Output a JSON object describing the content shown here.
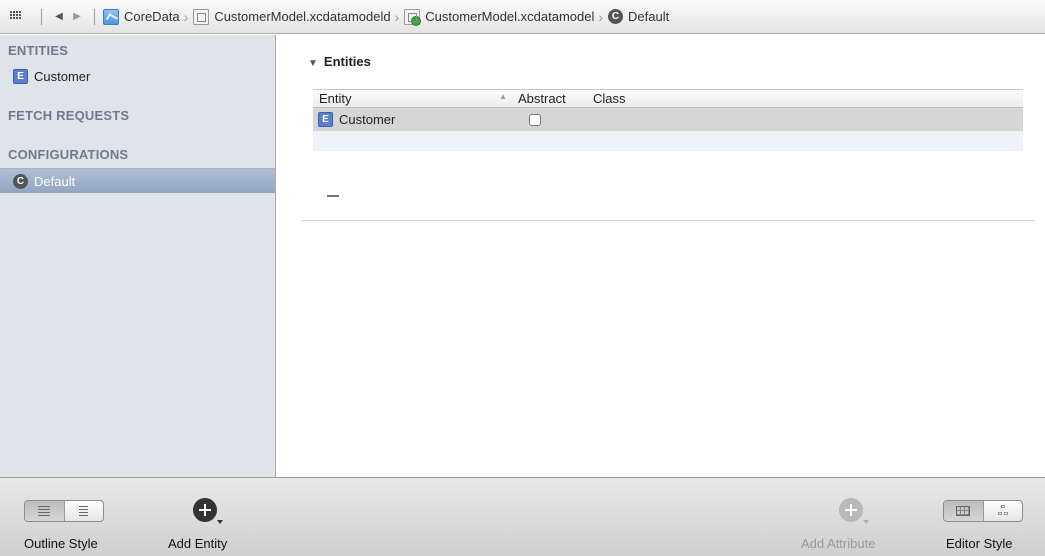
{
  "jumpbar": {
    "crumbs": [
      "CoreData",
      "CustomerModel.xcdatamodeld",
      "CustomerModel.xcdatamodel",
      "Default"
    ],
    "icons": [
      "related-items-grid-icon",
      "back-arrow-icon",
      "forward-arrow-icon"
    ]
  },
  "sidebar": {
    "entities_header": "ENTITIES",
    "entities": [
      {
        "badge": "E",
        "label": "Customer"
      }
    ],
    "fetch_requests_header": "FETCH REQUESTS",
    "configurations_header": "CONFIGURATIONS",
    "configurations": [
      {
        "badge": "C",
        "label": "Default",
        "selected": true
      }
    ]
  },
  "main": {
    "group_title": "Entities",
    "columns": {
      "entity": "Entity",
      "abstract": "Abstract",
      "class": "Class"
    },
    "rows": [
      {
        "badge": "E",
        "entity": "Customer",
        "abstract": false,
        "class": ""
      }
    ],
    "remove_symbol": "–"
  },
  "bottombar": {
    "outline_style_label": "Outline Style",
    "add_entity_label": "Add Entity",
    "add_attribute_label": "Add Attribute",
    "editor_style_label": "Editor Style"
  },
  "colors": {
    "sidebar_bg": "#dfe4ea",
    "selection": "#91a6c3",
    "entity_badge": "#5a7fcf",
    "row_highlight": "#d5d5d5"
  }
}
